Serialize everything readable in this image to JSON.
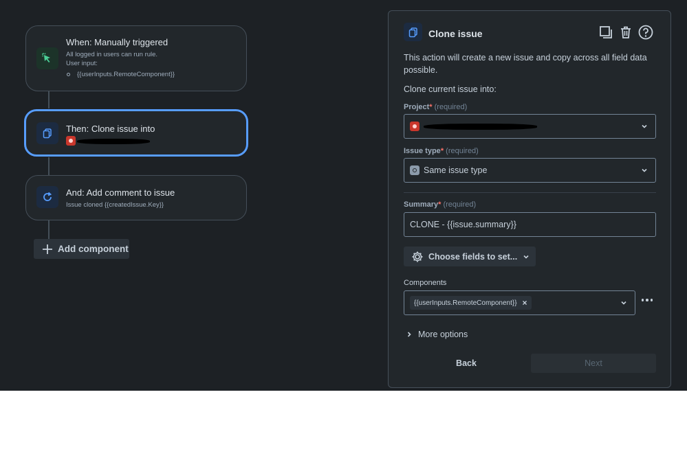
{
  "flow": {
    "trigger": {
      "title": "When: Manually triggered",
      "line1": "All logged in users can run rule.",
      "line2": "User input:",
      "input_item": "{{userInputs.RemoteComponent}}",
      "icon": "cursor-click-icon"
    },
    "action": {
      "title": "Then: Clone issue into",
      "icon": "copy-icon"
    },
    "followup": {
      "title": "And: Add comment to issue",
      "subtitle": "Issue cloned {{createdIssue.Key}}",
      "icon": "refresh-icon"
    },
    "add_component_label": "Add component"
  },
  "panel": {
    "title": "Clone issue",
    "description": "This action will create a new issue and copy across all field data possible.",
    "section_label": "Clone current issue into:",
    "project": {
      "label": "Project",
      "required_mark": "*",
      "required_text": "(required)"
    },
    "issue_type": {
      "label": "Issue type",
      "required_mark": "*",
      "required_text": "(required)",
      "value": "Same issue type"
    },
    "summary": {
      "label": "Summary",
      "required_mark": "*",
      "required_text": "(required)",
      "value": "CLONE - {{issue.summary}}"
    },
    "choose_fields_label": "Choose fields to set...",
    "components": {
      "label": "Components",
      "chip": "{{userInputs.RemoteComponent}}",
      "chip_remove": "×"
    },
    "more_options_label": "More options",
    "back_label": "Back",
    "next_label": "Next"
  },
  "colors": {
    "background": "#1d2125",
    "surface": "#22272b",
    "accent": "#579dff",
    "required": "#f87168"
  }
}
